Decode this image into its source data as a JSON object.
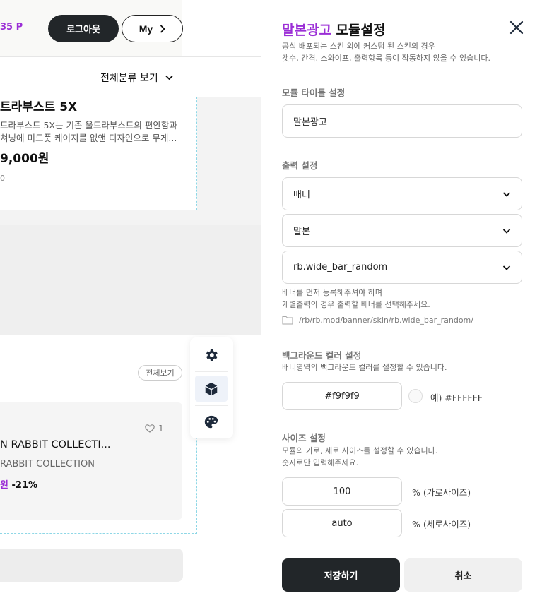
{
  "background_page": {
    "header": {
      "points_text": "35 P",
      "logout_label": "로그아웃",
      "my_label": "My"
    },
    "category_toggle_label": "전체분류 보기",
    "product_1": {
      "title": "트라부스트 5X",
      "desc_line1": "트라부스트 5X는 기존 울트라부스트의 편안함과",
      "desc_line2": "쳐닝에 미드풋 케이지를 없앤 디자인으로 무게...",
      "price": "9,000원",
      "count": "0"
    },
    "section_2": {
      "view_all_label": "전체보기",
      "like_count": "1",
      "product_title": "N RABBIT COLLECTI...",
      "product_brand": "RABBIT COLLECTION",
      "price_currency": "원",
      "discount": "-21%"
    },
    "tools": [
      "gear-icon",
      "cube-icon",
      "palette-icon"
    ]
  },
  "panel": {
    "title_accent": "말본광고",
    "title_rest": " 모듈설정",
    "notice_line1": "공식 배포되는 스킨 외에 커스텀 된 스킨의 경우",
    "notice_line2": "갯수, 간격, 스와이프, 출력항목 등이 작동하지 않을 수 있습니다.",
    "title_section": {
      "label": "모듈 타이틀 설정",
      "value": "말본광고"
    },
    "output_section": {
      "label": "출력 설정",
      "type_value": "배너",
      "target_value": "말본",
      "skin_value": "rb.wide_bar_random",
      "hint_line1": "배너를 먼저 등록해주셔야 하며",
      "hint_line2": "개별출력의 경우 출력할 배너를 선택해주세요.",
      "skin_path": "/rb/rb.mod/banner/skin/rb.wide_bar_random/"
    },
    "bg_color_section": {
      "label": "백그라운드 컬러 설정",
      "hint": "배너영역의 백그라운드 컬러를 설정할 수 있습니다.",
      "value": "#f9f9f9",
      "example": "예) #FFFFFF",
      "swatch_color": "#f9f9f9"
    },
    "size_section": {
      "label": "사이즈 설정",
      "hint_line1": "모듈의 가로, 세로 사이즈를 설정할 수 있습니다.",
      "hint_line2": "숫자로만 입력해주세요.",
      "width_value": "100",
      "width_suffix": "% (가로사이즈)",
      "height_value": "auto",
      "height_suffix": "% (세로사이즈)"
    },
    "save_label": "저장하기",
    "cancel_label": "취소"
  },
  "colors": {
    "accent": "#9b2ed6",
    "dark_button": "#222629",
    "guide_dash": "#8ed7e6"
  }
}
